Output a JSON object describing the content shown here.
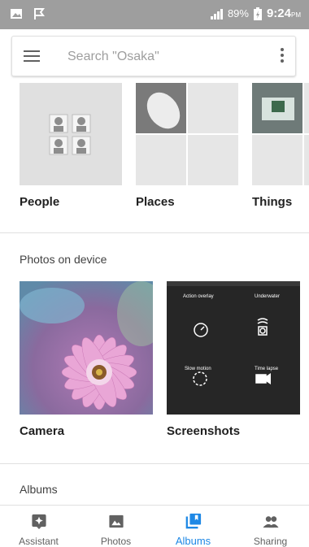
{
  "status_bar": {
    "battery": "89%",
    "time": "9:24",
    "time_suffix": "PM"
  },
  "search": {
    "placeholder": "Search \"Osaka\""
  },
  "things": [
    {
      "label": "People"
    },
    {
      "label": "Places"
    },
    {
      "label": "Things"
    }
  ],
  "device_section": {
    "title": "Photos on device",
    "albums": [
      {
        "label": "Camera"
      },
      {
        "label": "Screenshots"
      }
    ]
  },
  "screenshot_tile": {
    "modes": [
      "Action overlay",
      "Underwater",
      "Slow motion",
      "Time lapse"
    ]
  },
  "albums_section": {
    "title": "Albums"
  },
  "bottom_nav": {
    "active": "Albums",
    "items": [
      {
        "label": "Assistant",
        "icon": "assistant-icon"
      },
      {
        "label": "Photos",
        "icon": "photo-icon"
      },
      {
        "label": "Albums",
        "icon": "albums-icon"
      },
      {
        "label": "Sharing",
        "icon": "people-icon"
      }
    ]
  },
  "colors": {
    "accent": "#1e88e5",
    "status_bar": "#9e9e9e"
  }
}
